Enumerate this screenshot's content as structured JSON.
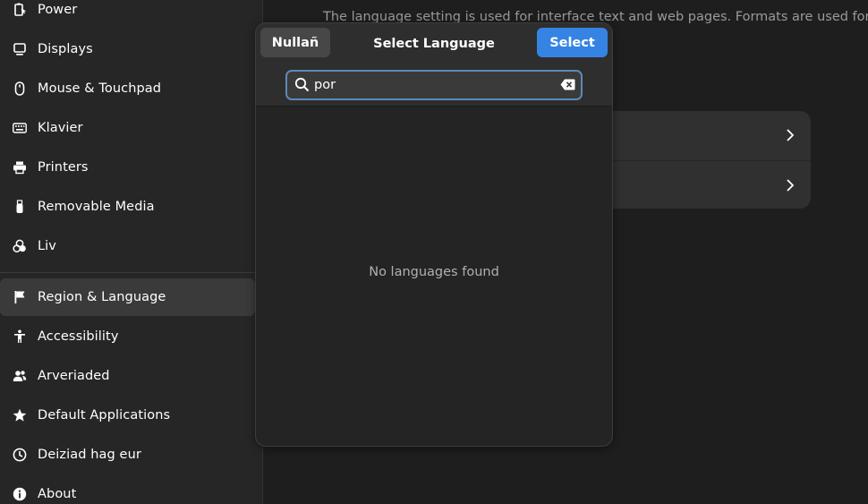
{
  "sidebar": {
    "items": [
      {
        "label": "Power",
        "icon": "power-icon"
      },
      {
        "label": "Displays",
        "icon": "display-icon"
      },
      {
        "label": "Mouse & Touchpad",
        "icon": "mouse-icon"
      },
      {
        "label": "Klavier",
        "icon": "keyboard-icon"
      },
      {
        "label": "Printers",
        "icon": "printer-icon"
      },
      {
        "label": "Removable Media",
        "icon": "usb-icon"
      },
      {
        "label": "Liv",
        "icon": "color-icon"
      },
      {
        "label": "Region & Language",
        "icon": "flag-icon",
        "selected": true
      },
      {
        "label": "Accessibility",
        "icon": "accessibility-icon"
      },
      {
        "label": "Arveriaded",
        "icon": "users-icon"
      },
      {
        "label": "Default Applications",
        "icon": "star-icon"
      },
      {
        "label": "Deiziad hag eur",
        "icon": "clock-icon"
      },
      {
        "label": "About",
        "icon": "info-icon"
      }
    ]
  },
  "main": {
    "description": "The language setting is used for interface text and web pages. Formats are used for"
  },
  "dialog": {
    "title": "Select Language",
    "cancel_label": "Nullañ",
    "select_label": "Select",
    "search_value": "por",
    "empty_message": "No languages found"
  },
  "colors": {
    "accent": "#3584e4",
    "sidebar_bg": "#262626",
    "window_bg": "#1e1e1e",
    "dialog_bg": "#242424"
  }
}
